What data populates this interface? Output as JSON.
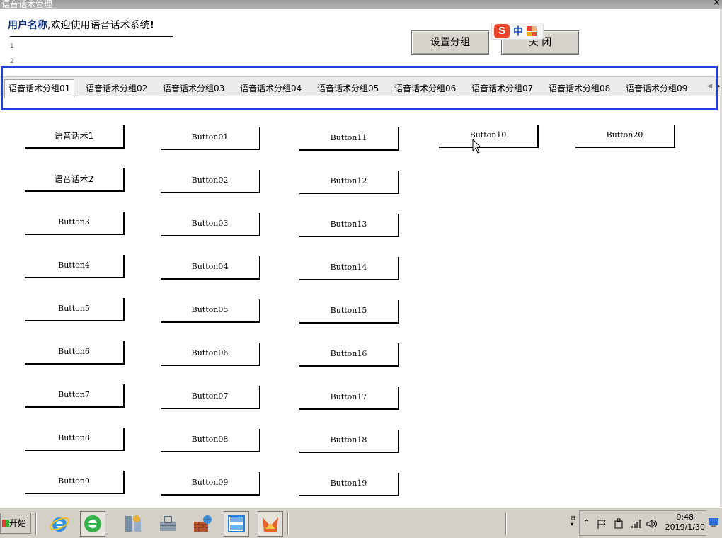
{
  "window": {
    "title": "语音话术管理",
    "close_glyph": "×"
  },
  "header": {
    "welcome_user": "用户名称",
    "welcome_text": ",欢迎使用语音话术系统",
    "welcome_excl": "!",
    "line_numbers": [
      "1",
      "2"
    ],
    "group_settings_button": "设置分组",
    "close_button": "关 闭"
  },
  "ime": {
    "logo": "S",
    "mode": "中",
    "colors": [
      "#e8462b",
      "#e8462b",
      "#f5a623",
      "#4a7bd8"
    ]
  },
  "tabs": [
    {
      "label": "语音话术分组01",
      "active": true
    },
    {
      "label": "语音话术分组02",
      "active": false
    },
    {
      "label": "语音话术分组03",
      "active": false
    },
    {
      "label": "语音话术分组04",
      "active": false
    },
    {
      "label": "语音话术分组05",
      "active": false
    },
    {
      "label": "语音话术分组06",
      "active": false
    },
    {
      "label": "语音话术分组07",
      "active": false
    },
    {
      "label": "语音话术分组08",
      "active": false
    },
    {
      "label": "语音话术分组09",
      "active": false
    }
  ],
  "tab_scroll": {
    "left": "◀",
    "right": "▶"
  },
  "columns": [
    [
      "语音话术1",
      "语音话术2",
      "Button3",
      "Button4",
      "Button5",
      "Button6",
      "Button7",
      "Button8",
      "Button9"
    ],
    [
      "Button01",
      "Button02",
      "Button03",
      "Button04",
      "Button05",
      "Button06",
      "Button07",
      "Button08",
      "Button09"
    ],
    [
      "Button11",
      "Button12",
      "Button13",
      "Button14",
      "Button15",
      "Button16",
      "Button17",
      "Button18",
      "Button19"
    ],
    [
      "Button10"
    ],
    [
      "Button20"
    ]
  ],
  "taskbar": {
    "start_label": "开始",
    "icons": [
      "ie-icon",
      "360-browser-icon",
      "server-manager-icon",
      "toolbox-icon",
      "network-icon",
      "window-list-icon",
      "foxmail-icon"
    ],
    "tray_icons": [
      "show-hidden-icon",
      "flag-icon",
      "usb-icon",
      "network-signal-icon",
      "volume-icon"
    ],
    "time": "9:48",
    "date": "2019/1/30"
  }
}
